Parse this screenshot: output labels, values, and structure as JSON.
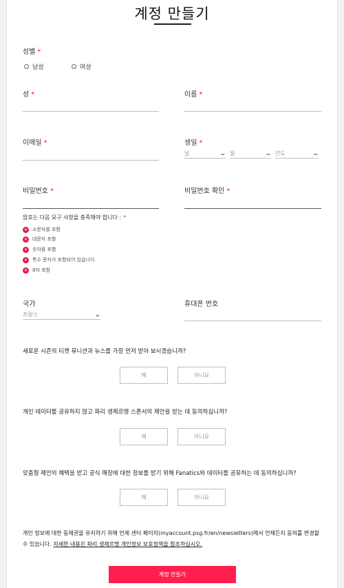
{
  "page_title": "계정 만들기",
  "gender": {
    "label": "성별",
    "options": [
      "남성",
      "여성"
    ]
  },
  "required_mark": "*",
  "fields": {
    "last_name": "성",
    "first_name": "이름",
    "email": "이메일",
    "birth": "생일",
    "password": "비밀번호",
    "password_confirm": "비밀번호 확인",
    "country": "국가",
    "phone": "휴대폰 번호"
  },
  "birth_selects": {
    "day": "날",
    "month": "월",
    "year": "년도"
  },
  "country_value": "프랑스",
  "password_hint": "암호는 다음 요구 사항을 충족해야 합니다 :",
  "password_requirements": [
    "소문자를 포함",
    "대문자 포함",
    "숫자를 포함",
    "특수 문자가 포함되어 있습니다.",
    "8자 포함"
  ],
  "questions": [
    {
      "text": "새로운 시즌의 티켓 뮤니션과 뉴스를 가장 먼저 받아 보시겠습니까?",
      "yes": "예",
      "no": "아니요"
    },
    {
      "text": "개인 데이터를 공유하지 않고 파리 생제르맹 스폰서의 제안을 받는 데 동의하십니까?",
      "yes": "예",
      "no": "아니요"
    },
    {
      "text": "맞춤형 제안의 혜택을 받고 공식 매장에 대한 정보를 받기 위해 Fanatics와 데이터를 공유하는 데 동의하십니까?",
      "yes": "예",
      "no": "아니요"
    }
  ],
  "consent": {
    "text": "개인 정보에 대한 동제권을 유지하기 위해 언제 센터 페이지(myaccount.psg.fr/en/newsletters)에서 언제든지 동의를 변경할 수 있습니다.",
    "link": "자세한 내용은 파리 생제르맹 개인정보 보호정책을 참조하십시오."
  },
  "submit_label": "계정 만들기",
  "colors": {
    "accent": "#ff1f4e",
    "required": "#e31b4d"
  }
}
